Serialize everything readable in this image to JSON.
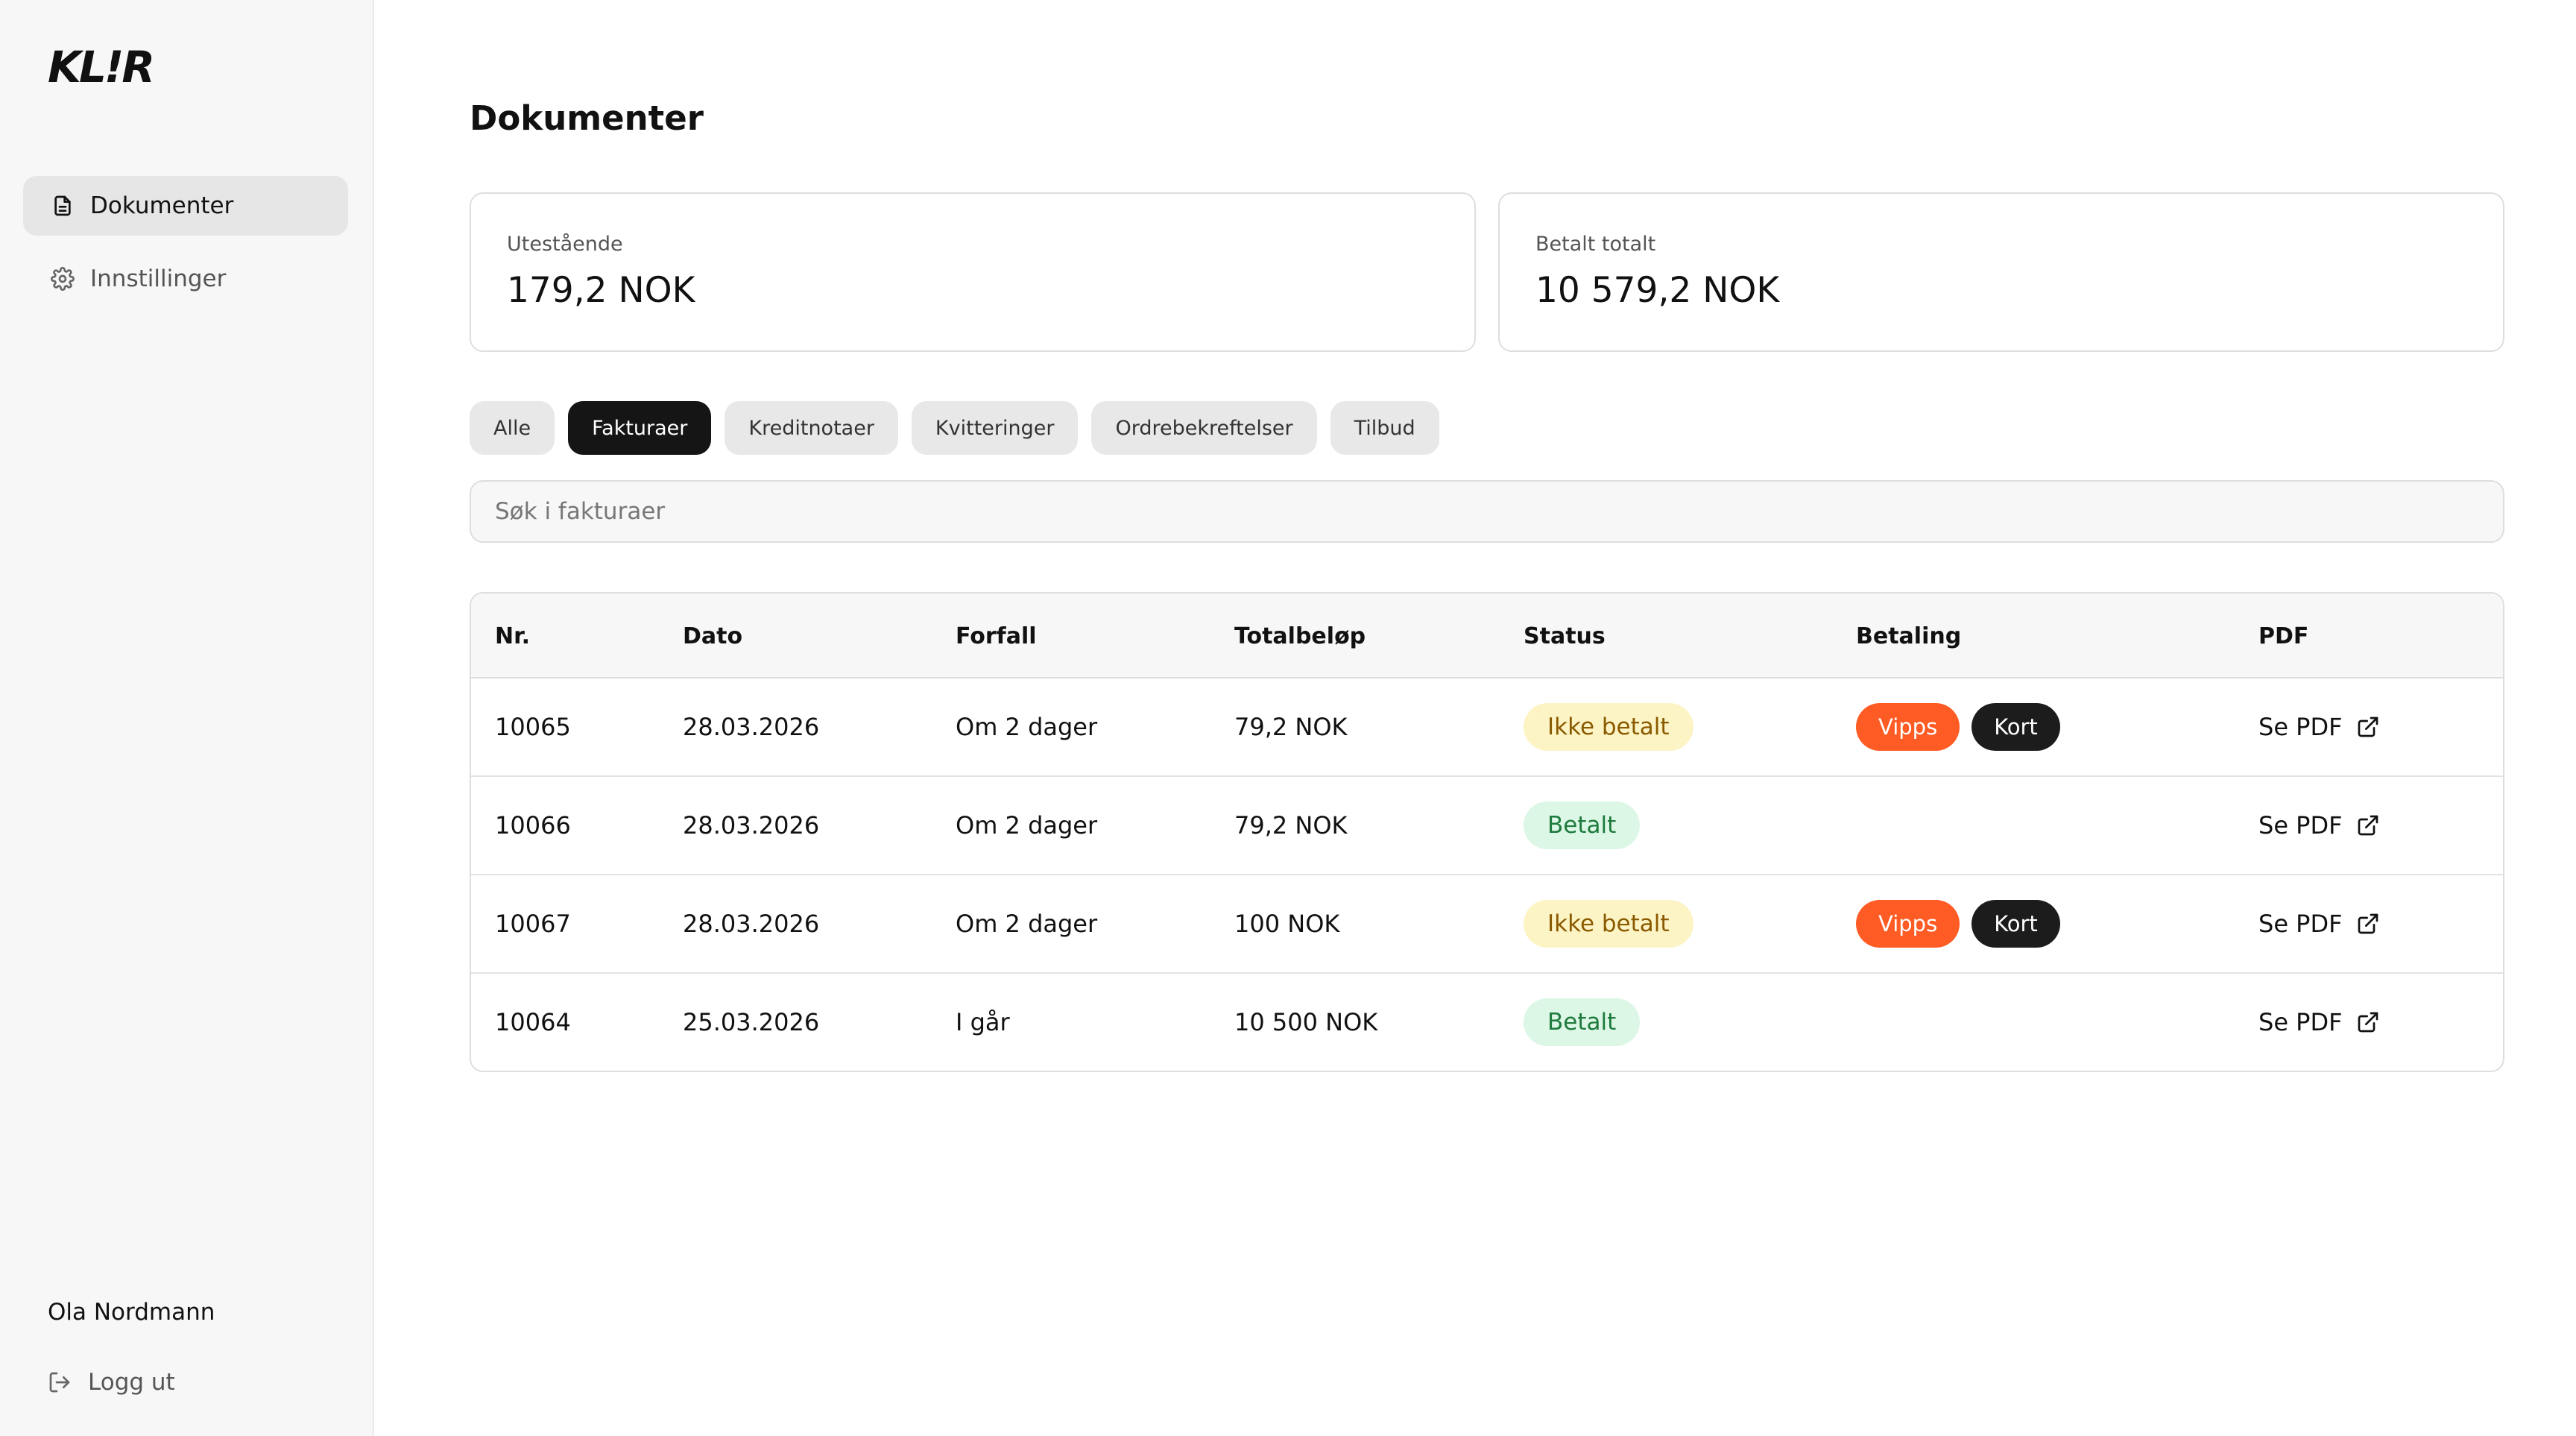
{
  "app": {
    "logo": "KL!R"
  },
  "sidebar": {
    "items": [
      {
        "label": "Dokumenter",
        "icon": "document-icon",
        "active": true
      },
      {
        "label": "Innstillinger",
        "icon": "gear-icon",
        "active": false
      }
    ],
    "user_name": "Ola Nordmann",
    "logout_label": "Logg ut"
  },
  "main": {
    "title": "Dokumenter",
    "cards": [
      {
        "label": "Utestående",
        "value": "179,2 NOK"
      },
      {
        "label": "Betalt totalt",
        "value": "10 579,2 NOK"
      }
    ],
    "filters": [
      {
        "label": "Alle",
        "active": false
      },
      {
        "label": "Fakturaer",
        "active": true
      },
      {
        "label": "Kreditnotaer",
        "active": false
      },
      {
        "label": "Kvitteringer",
        "active": false
      },
      {
        "label": "Ordrebekreftelser",
        "active": false
      },
      {
        "label": "Tilbud",
        "active": false
      }
    ],
    "search": {
      "placeholder": "Søk i fakturaer",
      "value": ""
    },
    "table": {
      "headers": [
        "Nr.",
        "Dato",
        "Forfall",
        "Totalbeløp",
        "Status",
        "Betaling",
        "PDF"
      ],
      "rows": [
        {
          "nr": "10065",
          "dato": "28.03.2026",
          "forfall": "Om 2 dager",
          "total": "79,2 NOK",
          "status": "Ikke betalt",
          "status_type": "unpaid",
          "payment": [
            "Vipps",
            "Kort"
          ],
          "pdf": "Se PDF"
        },
        {
          "nr": "10066",
          "dato": "28.03.2026",
          "forfall": "Om 2 dager",
          "total": "79,2 NOK",
          "status": "Betalt",
          "status_type": "paid",
          "payment": [],
          "pdf": "Se PDF"
        },
        {
          "nr": "10067",
          "dato": "28.03.2026",
          "forfall": "Om 2 dager",
          "total": "100 NOK",
          "status": "Ikke betalt",
          "status_type": "unpaid",
          "payment": [
            "Vipps",
            "Kort"
          ],
          "pdf": "Se PDF"
        },
        {
          "nr": "10064",
          "dato": "25.03.2026",
          "forfall": "I går",
          "total": "10 500 NOK",
          "status": "Betalt",
          "status_type": "paid",
          "payment": [],
          "pdf": "Se PDF"
        }
      ]
    }
  },
  "colors": {
    "vipps": "#ff5b24",
    "kort": "#1c1c1c",
    "unpaid_bg": "#fdf4c6",
    "paid_bg": "#dcf7e5",
    "active_chip": "#151515"
  }
}
